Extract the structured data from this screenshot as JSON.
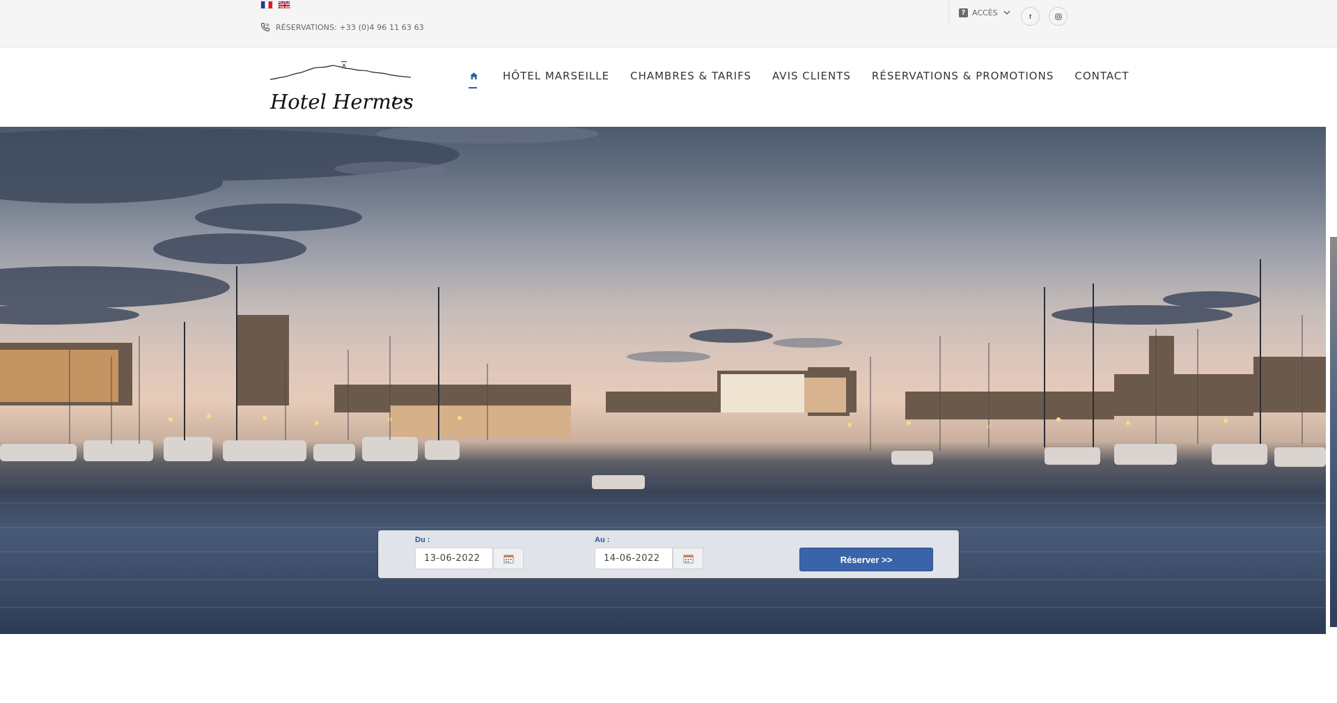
{
  "topbar": {
    "languages": [
      {
        "code": "fr",
        "icon": "flag-fr-icon"
      },
      {
        "code": "en",
        "icon": "flag-en-icon"
      }
    ],
    "reservations_text": "RÉSERVATIONS: +33 (0)4 96 11 63 63",
    "acces_label": "ACCÈS",
    "social": [
      {
        "name": "facebook",
        "glyph": "f"
      },
      {
        "name": "instagram",
        "glyph": "◎"
      }
    ]
  },
  "header": {
    "logo_text": "Hotel Hermes",
    "nav": [
      {
        "label": "HÔTEL MARSEILLE"
      },
      {
        "label": "CHAMBRES & TARIFS"
      },
      {
        "label": "AVIS CLIENTS"
      },
      {
        "label": "RÉSERVATIONS & PROMOTIONS"
      },
      {
        "label": "CONTACT"
      }
    ],
    "active_accent": "#2f5f9e"
  },
  "booking": {
    "from_label": "Du :",
    "from_value": "13-06-2022",
    "to_label": "Au :",
    "to_value": "14-06-2022",
    "submit_label": "Réserver >>",
    "button_color": "#3a64aa"
  }
}
